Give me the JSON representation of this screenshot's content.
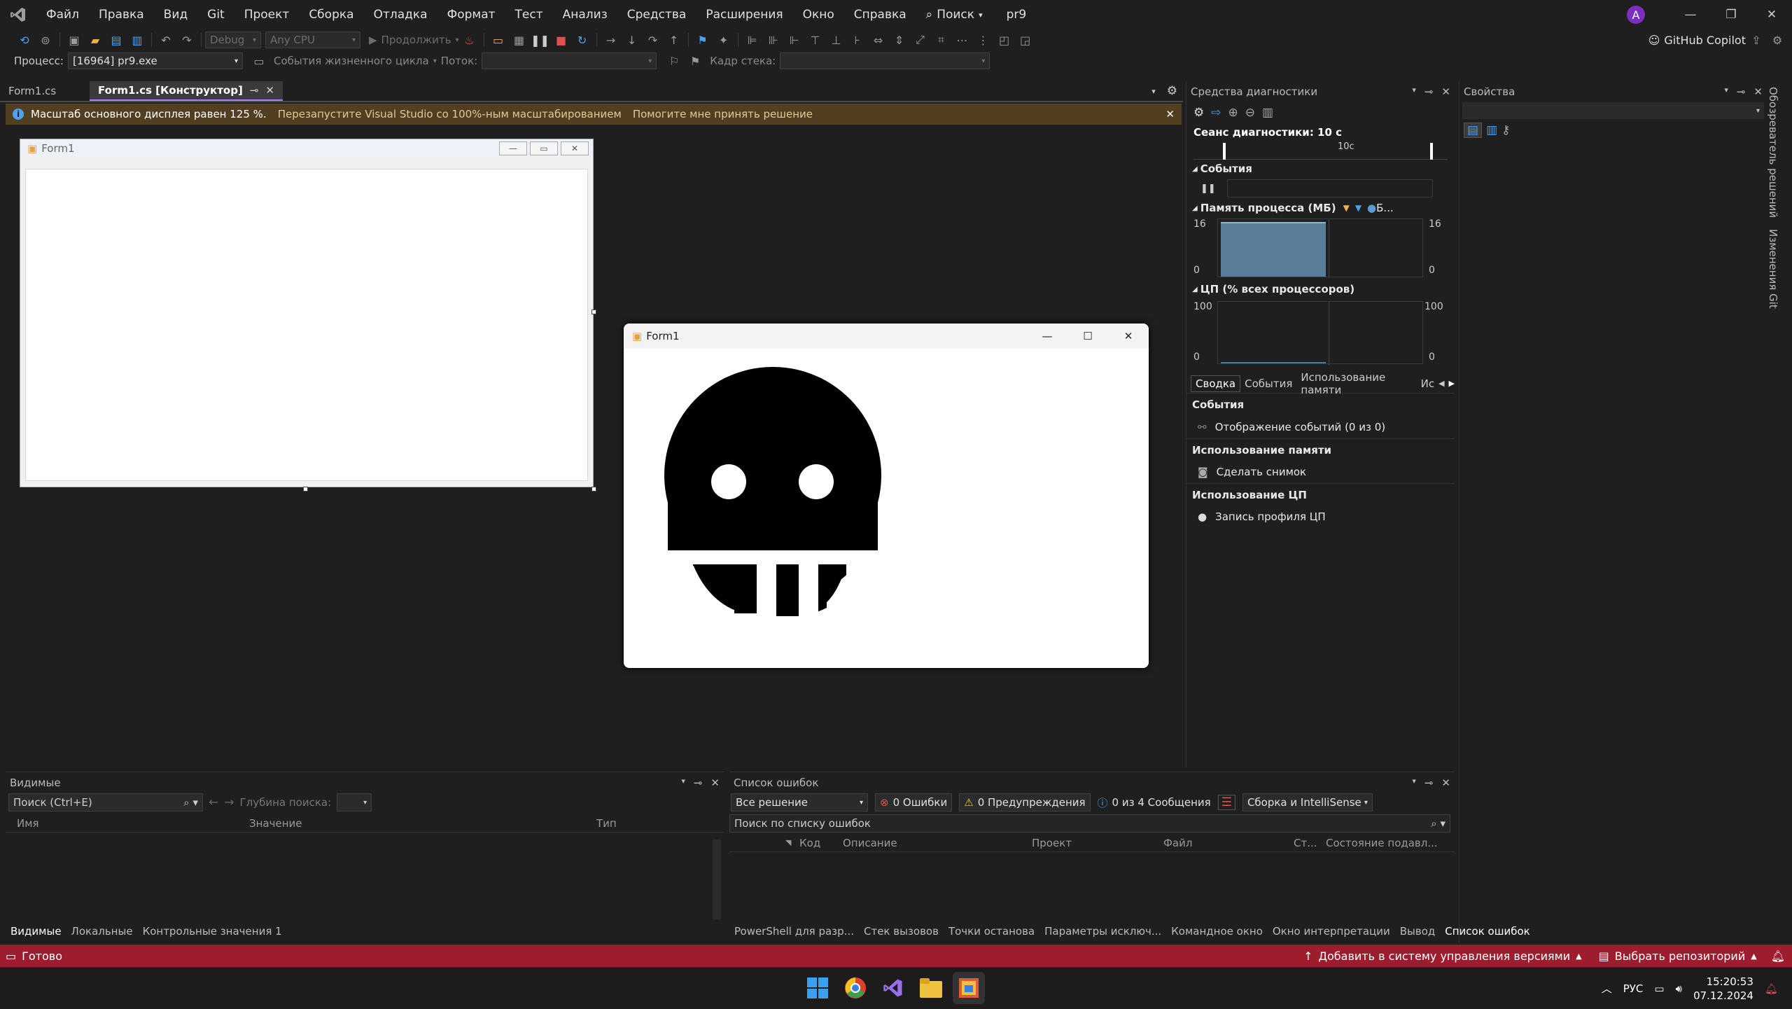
{
  "menubar": {
    "items": [
      "Файл",
      "Правка",
      "Вид",
      "Git",
      "Проект",
      "Сборка",
      "Отладка",
      "Формат",
      "Тест",
      "Анализ",
      "Средства",
      "Расширения",
      "Окно",
      "Справка"
    ],
    "search_label": "Поиск",
    "project_name": "pr9",
    "avatar_letter": "A"
  },
  "toolbar1": {
    "config": "Debug",
    "platform": "Any CPU",
    "continue_label": "Продолжить",
    "copilot_label": "GitHub Copilot"
  },
  "toolbar2": {
    "process_label": "Процесс:",
    "process_value": "[16964] pr9.exe",
    "lifecycle_label": "События жизненного цикла",
    "thread_label": "Поток:",
    "stack_label": "Кадр стека:"
  },
  "doc_tabs": [
    {
      "label": "Form1.cs",
      "active": false
    },
    {
      "label": "Form1.cs [Конструктор]",
      "active": true
    }
  ],
  "infobar": {
    "message": "Масштаб основного дисплея равен 125 %.",
    "link1": "Перезапустите Visual Studio со 100%-ным масштабированием",
    "link2": "Помогите мне принять решение"
  },
  "designer": {
    "form_title": "Form1"
  },
  "runform": {
    "title": "Form1"
  },
  "diagnostics": {
    "title": "Средства диагностики",
    "session": "Сеанс диагностики: 10 с",
    "timeline_label": "10с",
    "events_header": "События",
    "memory_header": "Память процесса (МБ)",
    "memory_legend": "Б...",
    "memory_max": "16",
    "memory_min": "0",
    "cpu_header": "ЦП (% всех процессоров)",
    "cpu_max": "100",
    "cpu_min": "0",
    "tabs": [
      "Сводка",
      "События",
      "Использование памяти",
      "Ис"
    ],
    "section_events": "События",
    "item_events": "Отображение событий (0 из 0)",
    "section_memory": "Использование памяти",
    "item_snapshot": "Сделать снимок",
    "section_cpu": "Использование ЦП",
    "item_cpu": "Запись профиля ЦП"
  },
  "properties": {
    "title": "Свойства"
  },
  "right_strip": [
    "Обозреватель решений",
    "Изменения Git"
  ],
  "watch": {
    "title": "Видимые",
    "search_placeholder": "Поиск (Ctrl+E)",
    "depth_label": "Глубина поиска:",
    "columns": [
      "Имя",
      "Значение",
      "Тип"
    ],
    "tabs": [
      "Видимые",
      "Локальные",
      "Контрольные значения 1"
    ]
  },
  "errors": {
    "title": "Список ошибок",
    "scope": "Все решение",
    "errors_btn": "0 Ошибки",
    "warnings_btn": "0 Предупреждения",
    "messages_btn": "0 из 4 Сообщения",
    "build_filter": "Сборка и IntelliSense",
    "search_placeholder": "Поиск по списку ошибок",
    "columns": [
      "Код",
      "Описание",
      "Проект",
      "Файл",
      "Ст...",
      "Состояние подавл..."
    ],
    "bottom_tabs": [
      "PowerShell для разр...",
      "Стек вызовов",
      "Точки останова",
      "Параметры исключ...",
      "Командное окно",
      "Окно интерпретации",
      "Вывод",
      "Список ошибок"
    ]
  },
  "statusbar": {
    "ready": "Готово",
    "add_vcs": "Добавить в систему управления версиями",
    "select_repo": "Выбрать репозиторий"
  },
  "taskbar": {
    "lang": "РУС",
    "time": "15:20:53",
    "date": "07.12.2024"
  },
  "colors": {
    "accent": "#b77cff",
    "statusbar": "#9d1c2d",
    "infobar": "#523f21",
    "memory_fill": "#5b7f99"
  }
}
